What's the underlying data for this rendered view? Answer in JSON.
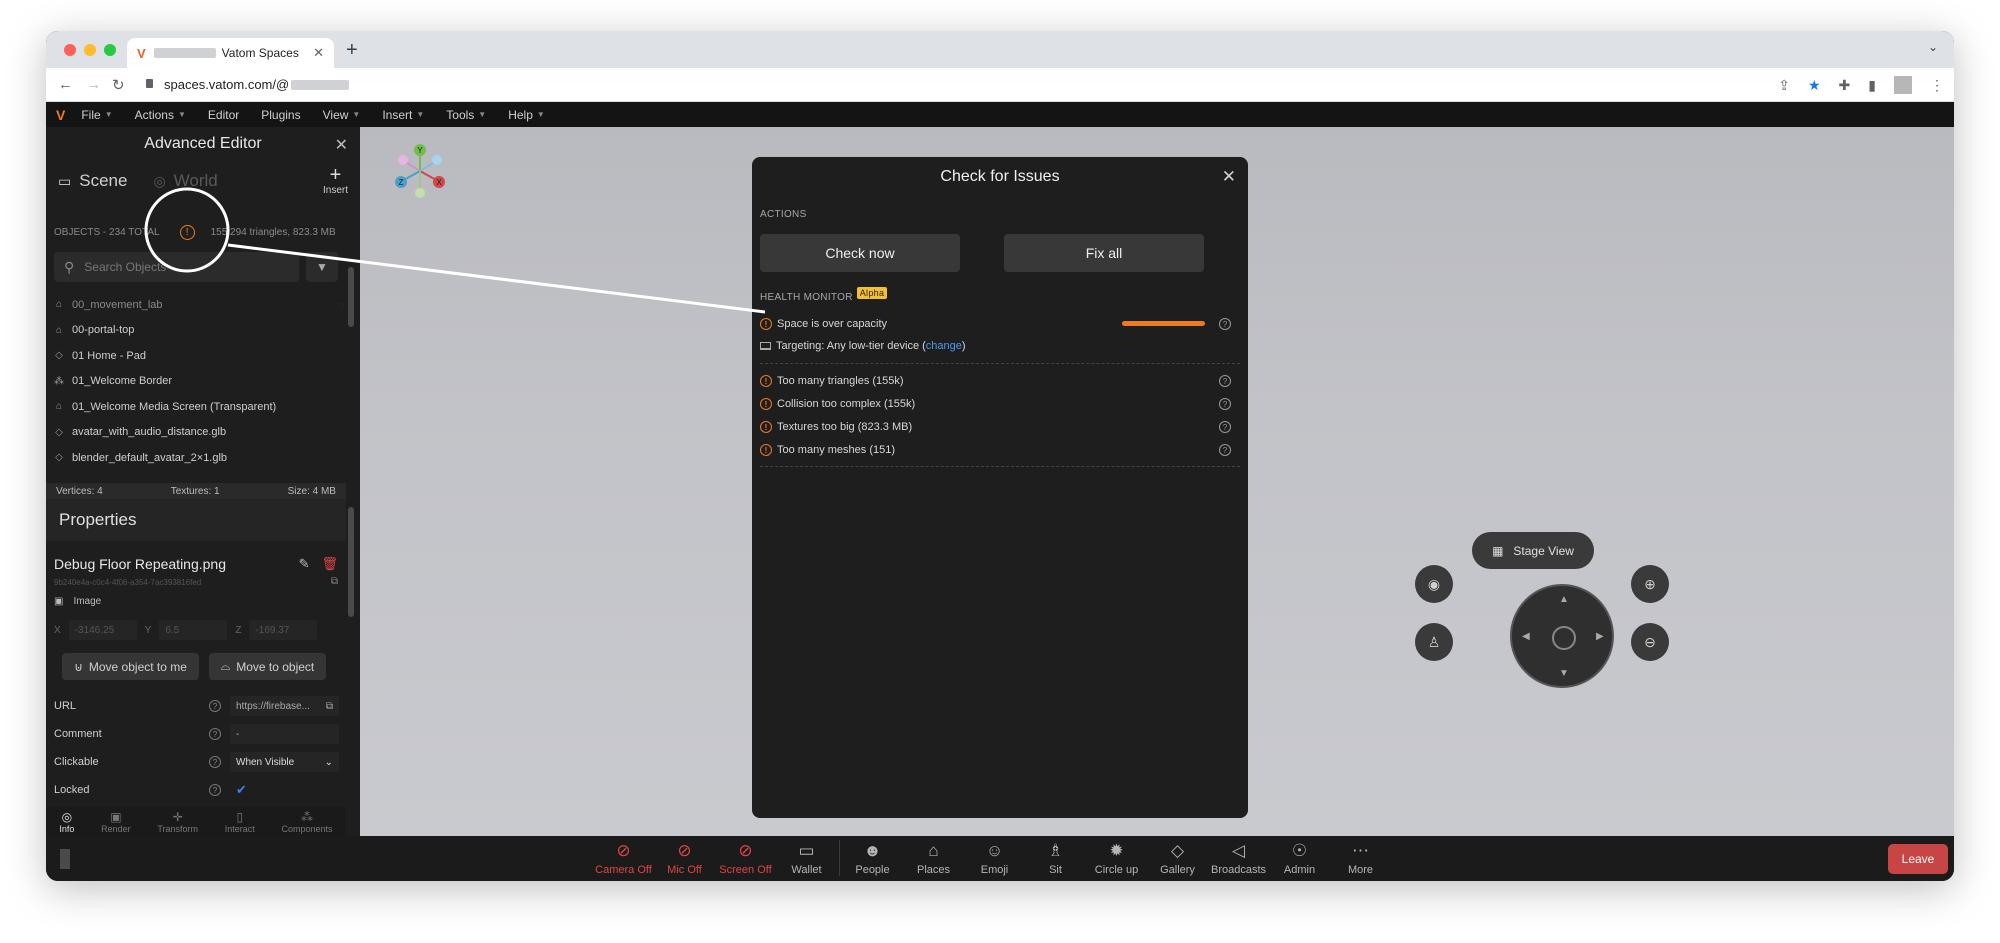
{
  "browser": {
    "tab_title": "Vatom Spaces",
    "url": "spaces.vatom.com/@"
  },
  "menubar": {
    "items": [
      "File",
      "Actions",
      "Editor",
      "Plugins",
      "View",
      "Insert",
      "Tools",
      "Help"
    ]
  },
  "sidebar": {
    "title": "Advanced Editor",
    "tab_scene": "Scene",
    "tab_world": "World",
    "insert_label": "Insert",
    "objects_total": "OBJECTS - 234 TOTAL",
    "objects_stats": "155,294 triangles, 823.3 MB",
    "search_placeholder": "Search Objects",
    "objects": [
      "00_movement_lab",
      "00-portal-top",
      "01 Home - Pad",
      "01_Welcome Border",
      "01_Welcome Media Screen (Transparent)",
      "avatar_with_audio_distance.glb",
      "blender_default_avatar_2×1.glb"
    ],
    "stats": {
      "vertices": "Vertices: 4",
      "textures": "Textures: 1",
      "size": "Size: 4 MB"
    },
    "properties_title": "Properties",
    "asset_name": "Debug Floor Repeating.png",
    "asset_id": "9b240e4a-c0c4-4f06-a354-7ac393816fed",
    "asset_type": "Image",
    "position": {
      "x_label": "X",
      "x": "-3146.25",
      "y_label": "Y",
      "y": "6.5",
      "z_label": "Z",
      "z": "-169.37"
    },
    "move_to_me": "Move object to me",
    "move_to_object": "Move to object",
    "props": {
      "url_label": "URL",
      "url_value": "https://firebase...",
      "comment_label": "Comment",
      "comment_value": "-",
      "clickable_label": "Clickable",
      "clickable_value": "When Visible",
      "locked_label": "Locked"
    },
    "bottom_tabs": [
      "Info",
      "Render",
      "Transform",
      "Interact",
      "Components"
    ]
  },
  "modal": {
    "title": "Check for Issues",
    "actions_label": "ACTIONS",
    "check_now": "Check now",
    "fix_all": "Fix all",
    "health_label": "HEALTH MONITOR",
    "alpha_badge": "Alpha",
    "capacity_label": "Space is over capacity",
    "capacity_level": 1.0,
    "targeting_prefix": "Targeting: Any low-tier device (",
    "targeting_link": "change",
    "targeting_suffix": ")",
    "issues": [
      "Too many triangles (155k)",
      "Collision too complex (155k)",
      "Textures too big (823.3 MB)",
      "Too many meshes (151)"
    ]
  },
  "toolbar": {
    "camera": "Camera Off",
    "mic": "Mic Off",
    "screen": "Screen Off",
    "wallet": "Wallet",
    "people": "People",
    "places": "Places",
    "emoji": "Emoji",
    "sit": "Sit",
    "circle_up": "Circle up",
    "gallery": "Gallery",
    "broadcasts": "Broadcasts",
    "admin": "Admin",
    "more": "More",
    "leave": "Leave"
  },
  "viewport": {
    "stage_view": "Stage View",
    "gizmo_axes": [
      "Y",
      "Z",
      "X"
    ]
  },
  "colors": {
    "accent": "#f07a22",
    "danger": "#e04545",
    "link": "#4a9cf0"
  }
}
